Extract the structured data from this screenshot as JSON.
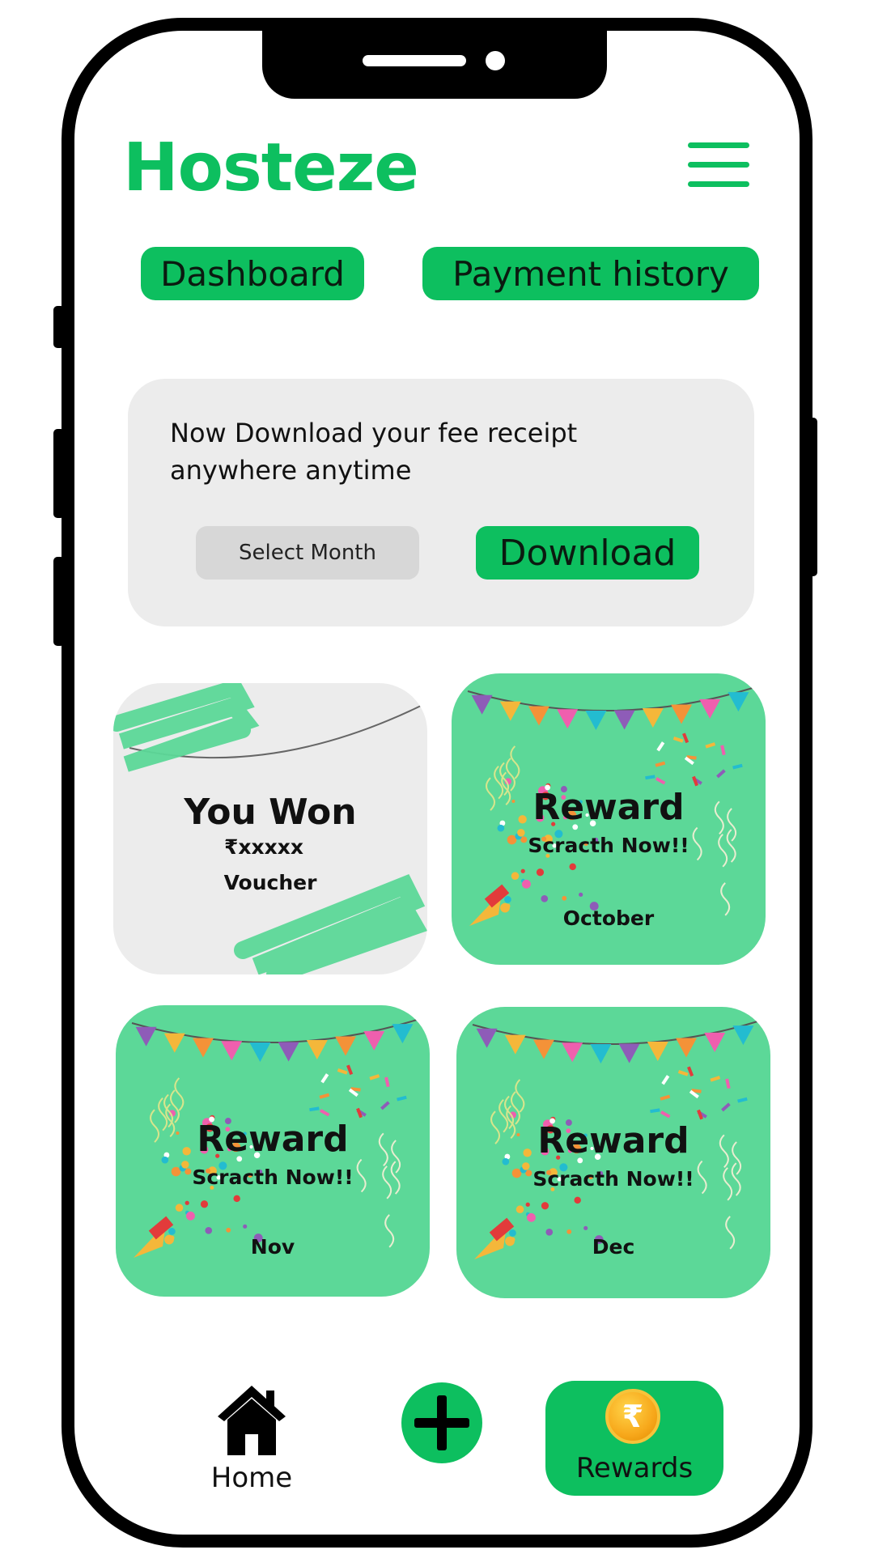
{
  "app": {
    "title": "Hosteze",
    "brand_color": "#0dbf5f",
    "card_color": "#5cd898"
  },
  "header": {
    "menu_icon": "hamburger-menu-icon"
  },
  "nav_tabs": [
    {
      "label": "Dashboard"
    },
    {
      "label": "Payment history"
    }
  ],
  "receipt": {
    "message_line1": "Now Download your fee receipt",
    "message_line2": "anywhere anytime",
    "select_placeholder": "Select Month",
    "download_label": "Download"
  },
  "cards": [
    {
      "title": "You Won",
      "amount": "₹xxxxx",
      "type": "Voucher",
      "state": "won"
    },
    {
      "title": "Reward",
      "subtitle": "Scracth Now!!",
      "month": "October",
      "state": "locked"
    },
    {
      "title": "Reward",
      "subtitle": "Scracth Now!!",
      "month": "Nov",
      "state": "locked"
    },
    {
      "title": "Reward",
      "subtitle": "Scracth Now!!",
      "month": "Dec",
      "state": "locked"
    }
  ],
  "bottom_nav": {
    "home_label": "Home",
    "home_icon": "home-icon",
    "add_icon": "plus-icon",
    "rewards_label": "Rewards",
    "rewards_icon": "rupee-coin-icon",
    "rupee_symbol": "₹"
  }
}
